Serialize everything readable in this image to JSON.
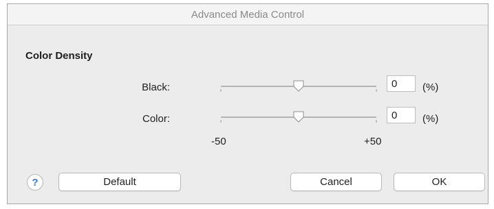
{
  "window": {
    "title": "Advanced Media Control"
  },
  "section": {
    "title": "Color Density"
  },
  "rows": [
    {
      "label": "Black:",
      "value": "0",
      "unit": "(%)",
      "slider_value": 0
    },
    {
      "label": "Color:",
      "value": "0",
      "unit": "(%)",
      "slider_value": 0
    }
  ],
  "scale": {
    "min_label": "-50",
    "max_label": "+50",
    "min": -50,
    "max": 50
  },
  "buttons": {
    "help": "?",
    "default": "Default",
    "cancel": "Cancel",
    "ok": "OK"
  },
  "colors": {
    "help_accent": "#2f7de1"
  }
}
